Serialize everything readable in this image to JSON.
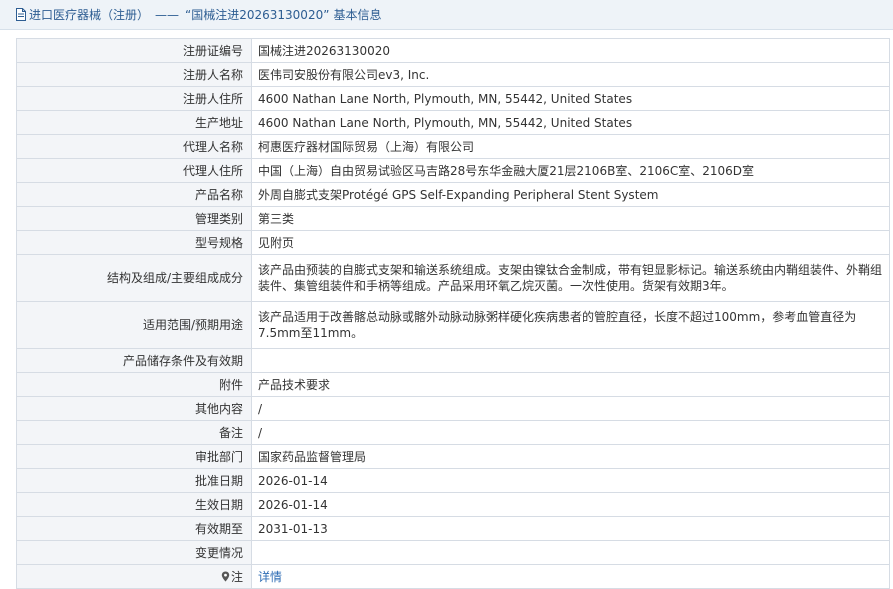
{
  "header": {
    "section": "进口医疗器械（注册）",
    "separator": "——",
    "record_title": "“国械注进20263130020”",
    "suffix": "基本信息"
  },
  "rows": [
    {
      "label": "注册证编号",
      "value": "国械注进20263130020"
    },
    {
      "label": "注册人名称",
      "value": "医伟司安股份有限公司ev3, Inc."
    },
    {
      "label": "注册人住所",
      "value": "4600 Nathan Lane North, Plymouth, MN, 55442, United States"
    },
    {
      "label": "生产地址",
      "value": "4600 Nathan Lane North, Plymouth, MN, 55442, United States"
    },
    {
      "label": "代理人名称",
      "value": "柯惠医疗器材国际贸易（上海）有限公司"
    },
    {
      "label": "代理人住所",
      "value": "中国（上海）自由贸易试验区马吉路28号东华金融大厦21层2106B室、2106C室、2106D室"
    },
    {
      "label": "产品名称",
      "value": "外周自膨式支架Protégé GPS Self-Expanding Peripheral Stent System"
    },
    {
      "label": "管理类别",
      "value": "第三类"
    },
    {
      "label": "型号规格",
      "value": "见附页"
    },
    {
      "label": "结构及组成/主要组成成分",
      "value": "该产品由预装的自膨式支架和输送系统组成。支架由镍钛合金制成，带有钽显影标记。输送系统由内鞘组装件、外鞘组装件、集管组装件和手柄等组成。产品采用环氧乙烷灭菌。一次性使用。货架有效期3年。"
    },
    {
      "label": "适用范围/预期用途",
      "value": "该产品适用于改善髂总动脉或髂外动脉动脉粥样硬化疾病患者的管腔直径，长度不超过100mm，参考血管直径为7.5mm至11mm。"
    },
    {
      "label": "产品储存条件及有效期",
      "value": ""
    },
    {
      "label": "附件",
      "value": "产品技术要求"
    },
    {
      "label": "其他内容",
      "value": "/"
    },
    {
      "label": "备注",
      "value": "/"
    },
    {
      "label": "审批部门",
      "value": "国家药品监督管理局"
    },
    {
      "label": "批准日期",
      "value": "2026-01-14"
    },
    {
      "label": "生效日期",
      "value": "2026-01-14"
    },
    {
      "label": "有效期至",
      "value": "2031-01-13"
    },
    {
      "label": "变更情况",
      "value": ""
    }
  ],
  "note_row": {
    "label": "注",
    "link_text": "详情",
    "icon": "pin-icon"
  },
  "colors": {
    "header_bg": "#eef3f8",
    "label_bg": "#f3f5f8",
    "border": "#d6dce4",
    "link": "#2d6cb4",
    "title_text": "#2d5d92"
  }
}
